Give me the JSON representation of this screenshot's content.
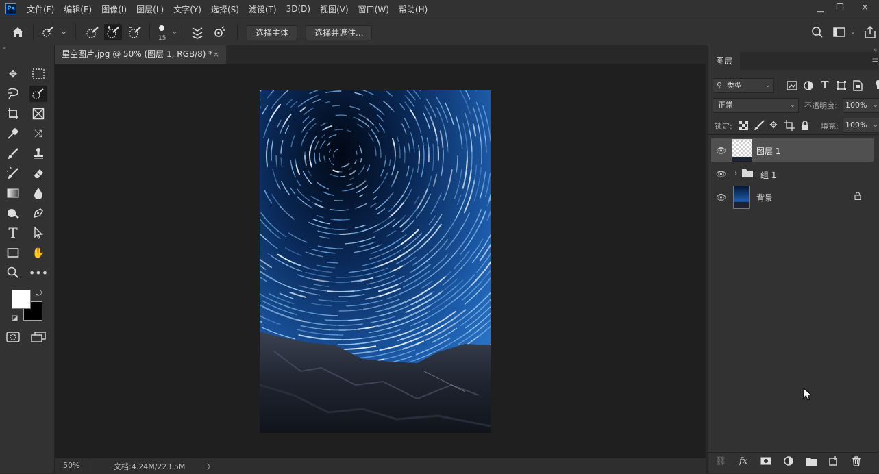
{
  "app": {
    "logo": "Ps"
  },
  "menu": [
    "文件(F)",
    "编辑(E)",
    "图像(I)",
    "图层(L)",
    "文字(Y)",
    "选择(S)",
    "滤镜(T)",
    "3D(D)",
    "视图(V)",
    "窗口(W)",
    "帮助(H)"
  ],
  "options": {
    "brush_size": "15",
    "select_subject_label": "选择主体",
    "select_mask_label": "选择并遮住..."
  },
  "document": {
    "tab_title": "星空图片.jpg @ 50% (图层 1, RGB/8) *",
    "close_glyph": "×"
  },
  "status": {
    "zoom": "50%",
    "doc_info": "文档:4.24M/223.5M",
    "arrow": "〉"
  },
  "layers_panel": {
    "tab_label": "图层",
    "filter_label": "类型",
    "blend_mode": "正常",
    "opacity_label": "不透明度:",
    "opacity_value": "100%",
    "lock_label": "锁定:",
    "fill_label": "填充:",
    "fill_value": "100%",
    "layers": [
      {
        "name": "图层 1",
        "selected": true,
        "type": "layer"
      },
      {
        "name": "组 1",
        "selected": false,
        "type": "group"
      },
      {
        "name": "背景",
        "selected": false,
        "type": "background",
        "locked": true
      }
    ]
  },
  "colors": {
    "accent": "#3fa0ff",
    "foreground": "#ffffff",
    "background": "#000000",
    "cursor_highlight": "#f2e21a"
  }
}
